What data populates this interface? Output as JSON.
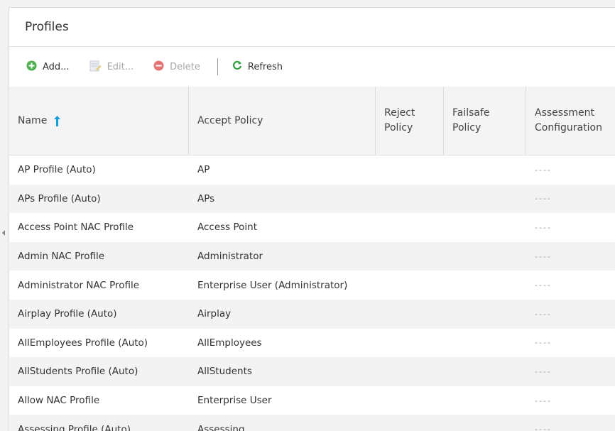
{
  "panel": {
    "title": "Profiles"
  },
  "toolbar": {
    "add_label": "Add...",
    "edit_label": "Edit...",
    "delete_label": "Delete",
    "refresh_label": "Refresh"
  },
  "table": {
    "columns": [
      {
        "label": "Name",
        "sorted": "ascending"
      },
      {
        "label": "Accept Policy"
      },
      {
        "label": "Reject Policy"
      },
      {
        "label": "Failsafe Policy"
      },
      {
        "label": "Assessment Configuration"
      }
    ],
    "rows": [
      {
        "name": "AP Profile (Auto)",
        "accept": "AP",
        "reject": "",
        "failsafe": "",
        "assessment": "----"
      },
      {
        "name": "APs Profile (Auto)",
        "accept": "APs",
        "reject": "",
        "failsafe": "",
        "assessment": "----"
      },
      {
        "name": "Access Point NAC Profile",
        "accept": "Access Point",
        "reject": "",
        "failsafe": "",
        "assessment": "----"
      },
      {
        "name": "Admin NAC Profile",
        "accept": "Administrator",
        "reject": "",
        "failsafe": "",
        "assessment": "----"
      },
      {
        "name": "Administrator NAC Profile",
        "accept": "Enterprise User (Administrator)",
        "reject": "",
        "failsafe": "",
        "assessment": "----"
      },
      {
        "name": "Airplay Profile (Auto)",
        "accept": "Airplay",
        "reject": "",
        "failsafe": "",
        "assessment": "----"
      },
      {
        "name": "AllEmployees Profile (Auto)",
        "accept": "AllEmployees",
        "reject": "",
        "failsafe": "",
        "assessment": "----"
      },
      {
        "name": "AllStudents Profile (Auto)",
        "accept": "AllStudents",
        "reject": "",
        "failsafe": "",
        "assessment": "----"
      },
      {
        "name": "Allow NAC Profile",
        "accept": "Enterprise User",
        "reject": "",
        "failsafe": "",
        "assessment": "----"
      },
      {
        "name": "Assessing Profile (Auto)",
        "accept": "Assessing",
        "reject": "",
        "failsafe": "",
        "assessment": "----"
      }
    ]
  },
  "colors": {
    "add_green": "#4caf50",
    "delete_red": "#e57373",
    "refresh_green": "#2e9e3e",
    "sort_arrow_blue": "#1a9ed9"
  },
  "icons": {
    "add": "add-circle-icon",
    "edit": "edit-note-icon",
    "delete": "delete-circle-icon",
    "refresh": "refresh-icon",
    "sort": "sort-ascending-arrow-icon"
  }
}
